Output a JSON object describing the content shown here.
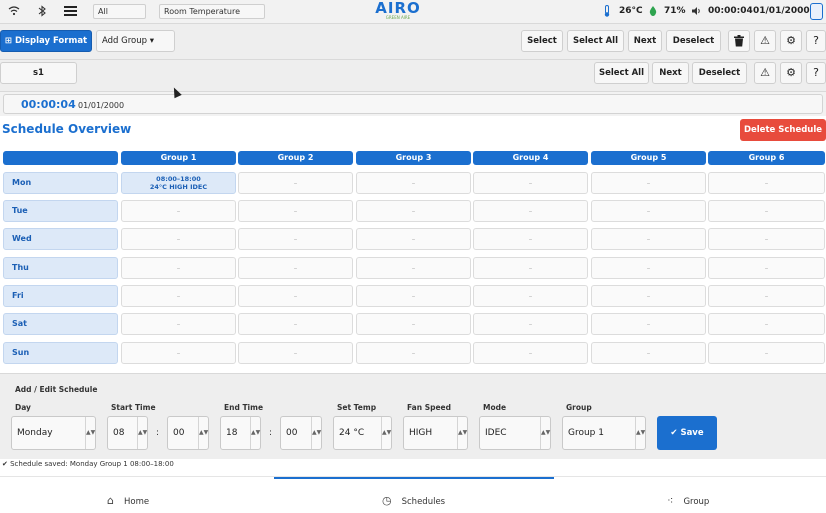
{
  "topbar": {
    "filter_value": "All",
    "sensor_value": "Room Temperature",
    "logo_text": "AIRO",
    "logo_sub": "GREEN AIRE",
    "temperature": "26°C",
    "humidity": "71%",
    "time": "00:00:04",
    "date": "01/01/2000",
    "icons": [
      "wifi-icon",
      "bluetooth-icon",
      "menu-icon",
      "thermometer-icon",
      "humidity-icon",
      "volume-icon"
    ]
  },
  "toolbar1": {
    "display_format": "Display Format",
    "add_group": "Add Group ▾",
    "select": "Select",
    "select_all": "Select All",
    "next": "Next",
    "deselect": "Deselect",
    "help": "?"
  },
  "toolbar2": {
    "tab": "s1",
    "select_all": "Select All",
    "next": "Next",
    "deselect": "Deselect",
    "help": "?"
  },
  "clock": {
    "time": "00:00:04",
    "date": "01/01/2000"
  },
  "schedule": {
    "title": "Schedule Overview",
    "delete_label": "Delete Schedule",
    "groups": [
      "Group 1",
      "Group 2",
      "Group 3",
      "Group 4",
      "Group 5",
      "Group 6"
    ],
    "days": [
      "Mon",
      "Tue",
      "Wed",
      "Thu",
      "Fri",
      "Sat",
      "Sun"
    ],
    "empty_mark": "–",
    "entry": {
      "day": "Mon",
      "group": "Group 1",
      "time": "08:00–18:00",
      "detail": "24°C  HIGH  IDEC"
    }
  },
  "editor": {
    "title": "Add / Edit Schedule",
    "labels": {
      "day": "Day",
      "start": "Start Time",
      "end": "End Time",
      "temp": "Set Temp",
      "fan": "Fan Speed",
      "mode": "Mode",
      "group": "Group"
    },
    "values": {
      "day": "Monday",
      "start_h": "08",
      "start_m": "00",
      "end_h": "18",
      "end_m": "00",
      "temp": "24 °C",
      "fan": "HIGH",
      "mode": "IDEC",
      "group": "Group 1"
    },
    "colon": ":",
    "save_label": "Save"
  },
  "status_message": "✔ Schedule saved: Monday  Group 1  08:00–18:00",
  "nav": {
    "home": "Home",
    "schedules": "Schedules",
    "group": "Group"
  },
  "colors": {
    "accent": "#1b6fcf",
    "danger": "#e84b3c"
  }
}
